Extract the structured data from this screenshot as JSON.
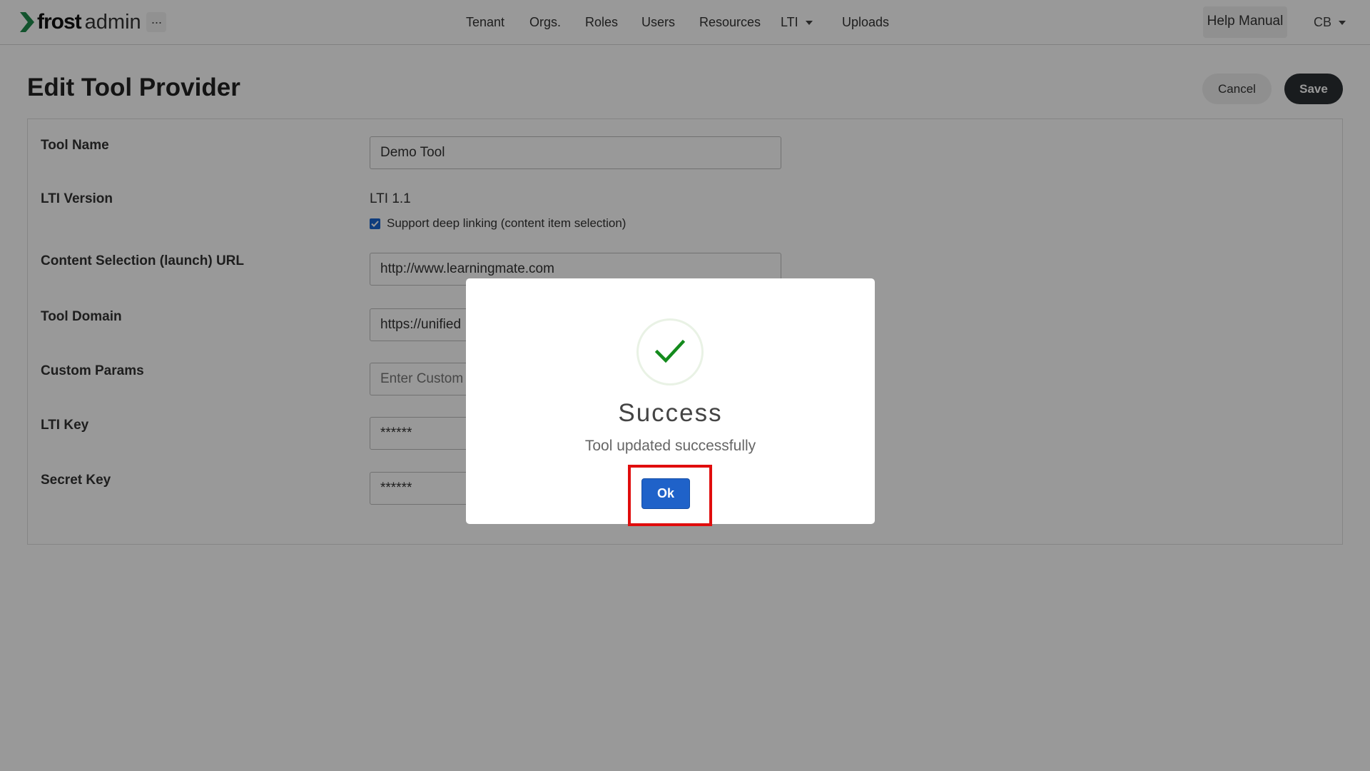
{
  "app": {
    "logo_brand": "frost",
    "logo_suffix": "admin",
    "more_label": "···"
  },
  "nav": {
    "items": [
      {
        "label": "Tenant"
      },
      {
        "label": "Orgs."
      },
      {
        "label": "Roles"
      },
      {
        "label": "Users"
      },
      {
        "label": "Resources"
      },
      {
        "label": "LTI",
        "has_dropdown": true
      },
      {
        "label": "Uploads"
      }
    ],
    "help_label": "Help Manual",
    "user_initials": "CB"
  },
  "page": {
    "title": "Edit Tool Provider",
    "cancel_label": "Cancel",
    "save_label": "Save"
  },
  "form": {
    "tool_name": {
      "label": "Tool Name",
      "value": "Demo Tool"
    },
    "lti_version": {
      "label": "LTI Version",
      "value": "LTI 1.1",
      "deep_linking_label": "Support deep linking (content item selection)",
      "deep_linking_checked": true
    },
    "launch_url": {
      "label": "Content Selection (launch) URL",
      "value": "http://www.learningmate.com"
    },
    "tool_domain": {
      "label": "Tool Domain",
      "value": "https://unified"
    },
    "custom_params": {
      "label": "Custom Params",
      "placeholder": "Enter Custom"
    },
    "lti_key": {
      "label": "LTI Key",
      "value": "******"
    },
    "secret_key": {
      "label": "Secret Key",
      "value": "******"
    }
  },
  "modal": {
    "icon": "checkmark-icon",
    "title": "Success",
    "message": "Tool updated successfully",
    "ok_label": "Ok"
  },
  "colors": {
    "logo_green": "#1f8a4c",
    "primary_blue": "#1f62c9",
    "save_dark": "#2a2f32",
    "success_green": "#138a1c",
    "highlight_red": "#e00d0d"
  }
}
